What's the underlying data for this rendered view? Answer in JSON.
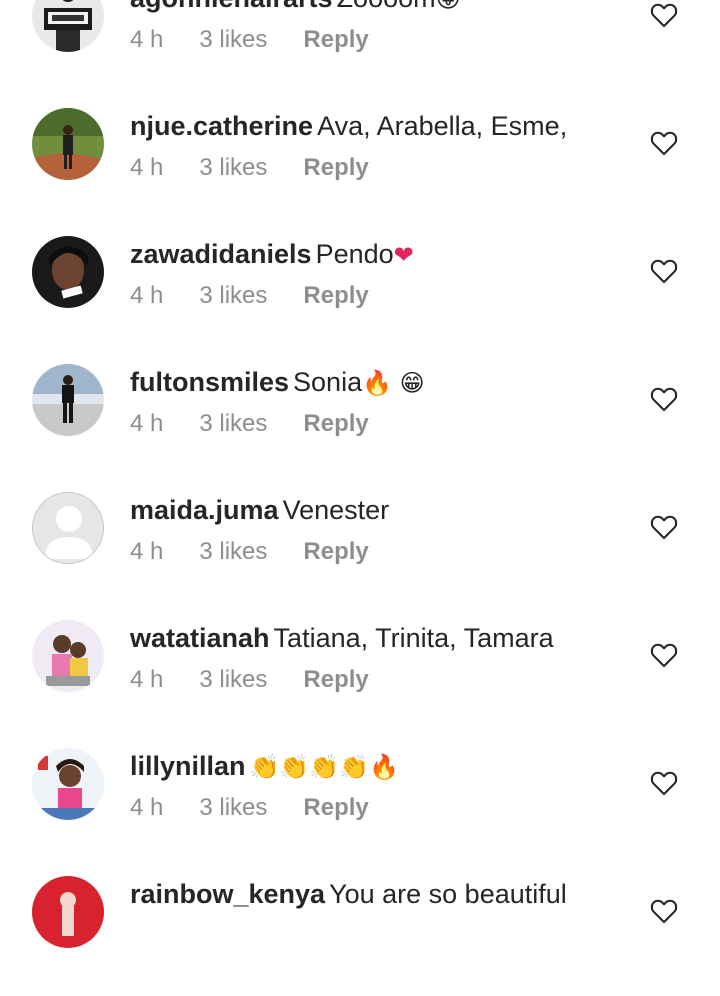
{
  "comments": [
    {
      "username": "agonniehairarts",
      "text": "Zoooom",
      "emoji": "😝",
      "time": "4 h",
      "likes": "3 likes",
      "reply": "Reply"
    },
    {
      "username": "njue.catherine",
      "text": "Ava,  Arabella,  Esme,",
      "emoji": "",
      "time": "4 h",
      "likes": "3 likes",
      "reply": "Reply"
    },
    {
      "username": "zawadidaniels",
      "text": "Pendo",
      "emoji": "❤",
      "time": "4 h",
      "likes": "3 likes",
      "reply": "Reply"
    },
    {
      "username": "fultonsmiles",
      "text": "Sonia",
      "emoji": "🔥 😁",
      "time": "4 h",
      "likes": "3 likes",
      "reply": "Reply"
    },
    {
      "username": "maida.juma",
      "text": "Venester",
      "emoji": "",
      "time": "4 h",
      "likes": "3 likes",
      "reply": "Reply"
    },
    {
      "username": "watatianah",
      "text": "Tatiana, Trinita, Tamara",
      "emoji": "",
      "time": "4 h",
      "likes": "3 likes",
      "reply": "Reply"
    },
    {
      "username": "lillynillan",
      "text": "",
      "emoji": "👏👏👏👏🔥",
      "time": "4 h",
      "likes": "3 likes",
      "reply": "Reply"
    },
    {
      "username": "rainbow_kenya",
      "text": "You are so beautiful",
      "emoji": "",
      "time": "",
      "likes": "",
      "reply": ""
    }
  ],
  "icons": {
    "like": "heart-outline-icon",
    "default_avatar": "default-avatar-icon"
  },
  "colors": {
    "username": "#262626",
    "meta": "#8e8e8e",
    "heart_emoji": "#e0245e"
  }
}
